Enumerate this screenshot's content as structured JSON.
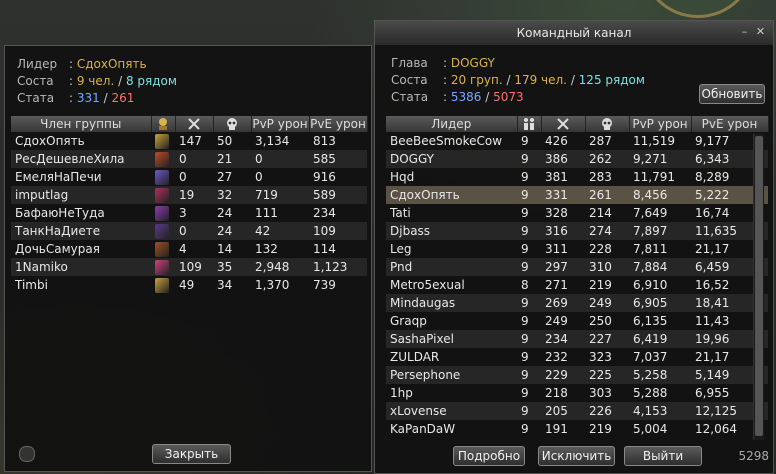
{
  "left": {
    "info": [
      {
        "label": "Лидер",
        "parts": [
          {
            "t": "СдохОпять",
            "c": "y"
          }
        ]
      },
      {
        "label": "Соста",
        "parts": [
          {
            "t": "9 чел.",
            "c": "y"
          },
          {
            "t": " / ",
            "c": "w"
          },
          {
            "t": "8 рядом",
            "c": "c"
          }
        ]
      },
      {
        "label": "Стата",
        "parts": [
          {
            "t": "331",
            "c": "b"
          },
          {
            "t": " / ",
            "c": "w"
          },
          {
            "t": "261",
            "c": "r"
          }
        ]
      }
    ],
    "columns": [
      "Член группы",
      "",
      "",
      "",
      "PvP урон",
      "PvE урон"
    ],
    "rows": [
      {
        "name": "СдохОпять",
        "cls": "#c9a23a",
        "k": "147",
        "d": "50",
        "pvp": "3,134",
        "pve": "813"
      },
      {
        "name": "РесДешевлеХила",
        "cls": "#c04a2a",
        "k": "0",
        "d": "21",
        "pvp": "0",
        "pve": "585"
      },
      {
        "name": "ЕмеляНаПечи",
        "cls": "#6a5acd",
        "k": "0",
        "d": "27",
        "pvp": "0",
        "pve": "916"
      },
      {
        "name": "imputlag",
        "cls": "#b03060",
        "k": "19",
        "d": "32",
        "pvp": "719",
        "pve": "589"
      },
      {
        "name": "БафаюНеТуда",
        "cls": "#8a3ab0",
        "k": "3",
        "d": "24",
        "pvp": "111",
        "pve": "234"
      },
      {
        "name": "ТанкНаДиете",
        "cls": "#5a3a8a",
        "k": "0",
        "d": "24",
        "pvp": "42",
        "pve": "109"
      },
      {
        "name": "ДочьСамурая",
        "cls": "#a05020",
        "k": "4",
        "d": "14",
        "pvp": "132",
        "pve": "114"
      },
      {
        "name": "1Namiko",
        "cls": "#d04080",
        "k": "109",
        "d": "35",
        "pvp": "2,948",
        "pve": "1,123"
      },
      {
        "name": "Timbi",
        "cls": "#c9a23a",
        "k": "49",
        "d": "34",
        "pvp": "1,370",
        "pve": "739"
      }
    ],
    "close_label": "Закрыть"
  },
  "right": {
    "title": "Командный канал",
    "info": [
      {
        "label": "Глава",
        "parts": [
          {
            "t": "DOGGY",
            "c": "y"
          }
        ]
      },
      {
        "label": "Соста",
        "parts": [
          {
            "t": "20 груп.",
            "c": "y"
          },
          {
            "t": " / ",
            "c": "w"
          },
          {
            "t": "179 чел.",
            "c": "y"
          },
          {
            "t": " / ",
            "c": "w"
          },
          {
            "t": "125 рядом",
            "c": "c"
          }
        ]
      },
      {
        "label": "Стата",
        "parts": [
          {
            "t": "5386",
            "c": "b"
          },
          {
            "t": " / ",
            "c": "w"
          },
          {
            "t": "5073",
            "c": "r"
          }
        ]
      }
    ],
    "refresh_label": "Обновить",
    "columns": [
      "Лидер",
      "",
      "",
      "",
      "PvP урон",
      "PvE урон"
    ],
    "rows": [
      {
        "name": "BeeBeeSmokeCow",
        "n": "9",
        "k": "426",
        "d": "287",
        "pvp": "11,519",
        "pve": "9,177"
      },
      {
        "name": "DOGGY",
        "n": "9",
        "k": "386",
        "d": "262",
        "pvp": "9,271",
        "pve": "6,343"
      },
      {
        "name": "Hqd",
        "n": "9",
        "k": "381",
        "d": "283",
        "pvp": "11,791",
        "pve": "8,289"
      },
      {
        "name": "СдохОпять",
        "n": "9",
        "k": "331",
        "d": "261",
        "pvp": "8,456",
        "pve": "5,222",
        "sel": true
      },
      {
        "name": "Tati",
        "n": "9",
        "k": "328",
        "d": "214",
        "pvp": "7,649",
        "pve": "16,74"
      },
      {
        "name": "Djbass",
        "n": "9",
        "k": "316",
        "d": "274",
        "pvp": "7,897",
        "pve": "11,635"
      },
      {
        "name": "Leg",
        "n": "9",
        "k": "311",
        "d": "228",
        "pvp": "7,811",
        "pve": "21,17"
      },
      {
        "name": "Pnd",
        "n": "9",
        "k": "297",
        "d": "310",
        "pvp": "7,884",
        "pve": "6,459"
      },
      {
        "name": "Metro5exual",
        "n": "8",
        "k": "271",
        "d": "219",
        "pvp": "6,910",
        "pve": "16,52"
      },
      {
        "name": "Mindaugas",
        "n": "9",
        "k": "269",
        "d": "249",
        "pvp": "6,905",
        "pve": "18,41"
      },
      {
        "name": "Graqp",
        "n": "9",
        "k": "249",
        "d": "250",
        "pvp": "6,135",
        "pve": "11,43"
      },
      {
        "name": "SashaPixel",
        "n": "9",
        "k": "234",
        "d": "227",
        "pvp": "6,419",
        "pve": "19,96"
      },
      {
        "name": "ZULDAR",
        "n": "9",
        "k": "232",
        "d": "323",
        "pvp": "7,037",
        "pve": "21,17"
      },
      {
        "name": "Persephone",
        "n": "9",
        "k": "229",
        "d": "225",
        "pvp": "5,258",
        "pve": "5,149"
      },
      {
        "name": "1hp",
        "n": "9",
        "k": "218",
        "d": "303",
        "pvp": "5,288",
        "pve": "6,955"
      },
      {
        "name": "xLovense",
        "n": "9",
        "k": "205",
        "d": "226",
        "pvp": "4,153",
        "pve": "12,125"
      },
      {
        "name": "KaPanDaW",
        "n": "9",
        "k": "191",
        "d": "219",
        "pvp": "5,004",
        "pve": "12,064"
      }
    ],
    "buttons": {
      "details": "Подробно",
      "exclude": "Исключить",
      "exit": "Выйти"
    },
    "corner_number": "5298"
  }
}
